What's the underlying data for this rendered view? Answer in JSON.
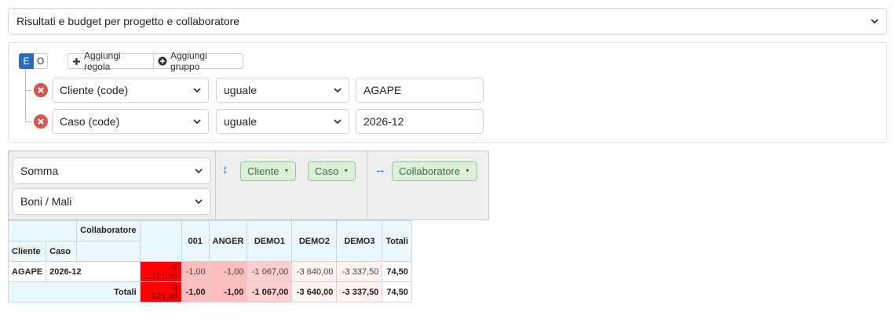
{
  "report_select": {
    "value": "Risultati e budget per progetto e collaboratore"
  },
  "query_builder": {
    "conditions": [
      "E",
      "O"
    ],
    "add_rule_label": "Aggiungi regola",
    "add_group_label": "Aggiungi gruppo",
    "rules": [
      {
        "field": "Cliente (code)",
        "operator": "uguale",
        "value": "AGAPE"
      },
      {
        "field": "Caso (code)",
        "operator": "uguale",
        "value": "2026-12"
      }
    ]
  },
  "pivot_config": {
    "aggregator": "Somma",
    "attribute": "Boni / Mali",
    "rows": [
      "Cliente",
      "Caso"
    ],
    "cols": [
      "Collaboratore"
    ]
  },
  "pivot_table": {
    "col_attr_label": "Collaboratore",
    "row_attr_labels": [
      "Cliente",
      "Caso"
    ],
    "columns": [
      "",
      "001",
      "ANGER",
      "DEMO1",
      "DEMO2",
      "DEMO3"
    ],
    "totals_label": "Totali",
    "rows": [
      {
        "cliente": "AGAPE",
        "caso": "2026-12",
        "values": [
          "-8 121,00",
          "-1,00",
          "-1,00",
          "-1 067,00",
          "-3 640,00",
          "-3 337,50"
        ],
        "total": "74,50"
      }
    ],
    "col_totals": [
      "-8 121,00",
      "-1,00",
      "-1,00",
      "-1 067,00",
      "-3 640,00",
      "-3 337,50"
    ],
    "grand_total": "74,50"
  },
  "colors": {
    "primary": "#2a6ebb",
    "danger": "#d9534f",
    "chip_bg": "#dff0d8",
    "heat_strong": "#ff0000",
    "heat_medium": "#ffbdbd",
    "heat_light": "#ffcece",
    "heat_pale": "#fff2f2",
    "heat_faint": "#fff5f5"
  }
}
